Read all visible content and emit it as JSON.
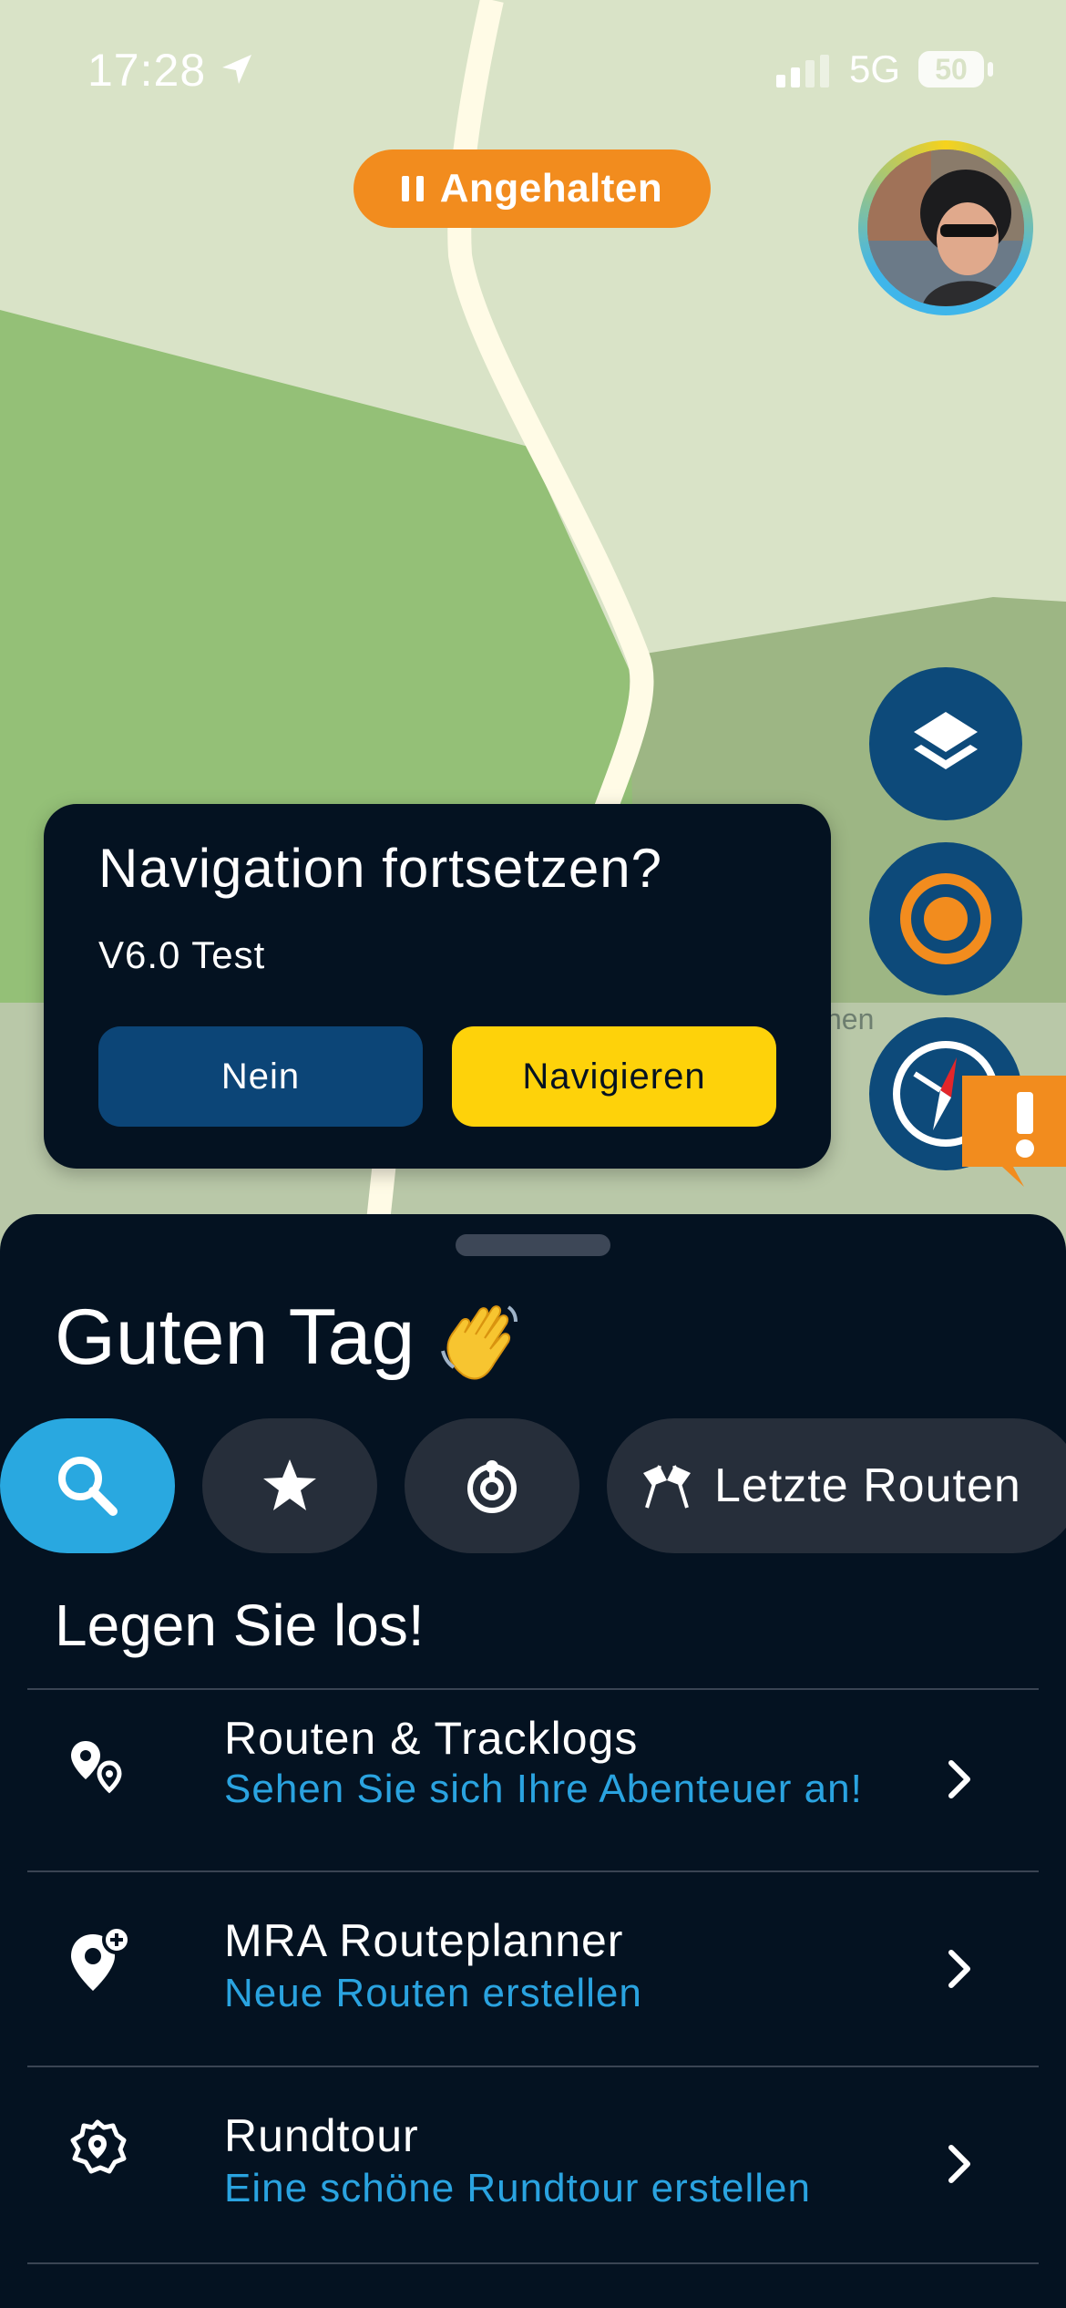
{
  "status_bar": {
    "time": "17:28",
    "network": "5G",
    "battery": "50"
  },
  "map": {
    "paused_label": "Angehalten",
    "label_fragment": "hen",
    "colors": {
      "accent_orange": "#f28c1e",
      "fab_blue": "#0d4a7a"
    }
  },
  "dialog": {
    "title": "Navigation fortsetzen?",
    "subtitle": "V6.0 Test",
    "no_label": "Nein",
    "go_label": "Navigieren"
  },
  "sheet": {
    "greeting": "Guten Tag",
    "greeting_emoji": "waving-hand",
    "chips": {
      "search": "search-icon",
      "favorites": "star-icon",
      "nearby": "radar-icon",
      "recent_label": "Letzte Routen"
    },
    "section_title": "Legen Sie los!",
    "items": [
      {
        "title": "Routen & Tracklogs",
        "subtitle": "Sehen Sie sich Ihre Abenteuer an!",
        "icon": "route-pins-icon"
      },
      {
        "title": "MRA Routeplanner",
        "subtitle": "Neue Routen erstellen",
        "icon": "add-pin-icon"
      },
      {
        "title": "Rundtour",
        "subtitle": "Eine schöne Rundtour erstellen",
        "icon": "round-trip-icon"
      }
    ]
  }
}
